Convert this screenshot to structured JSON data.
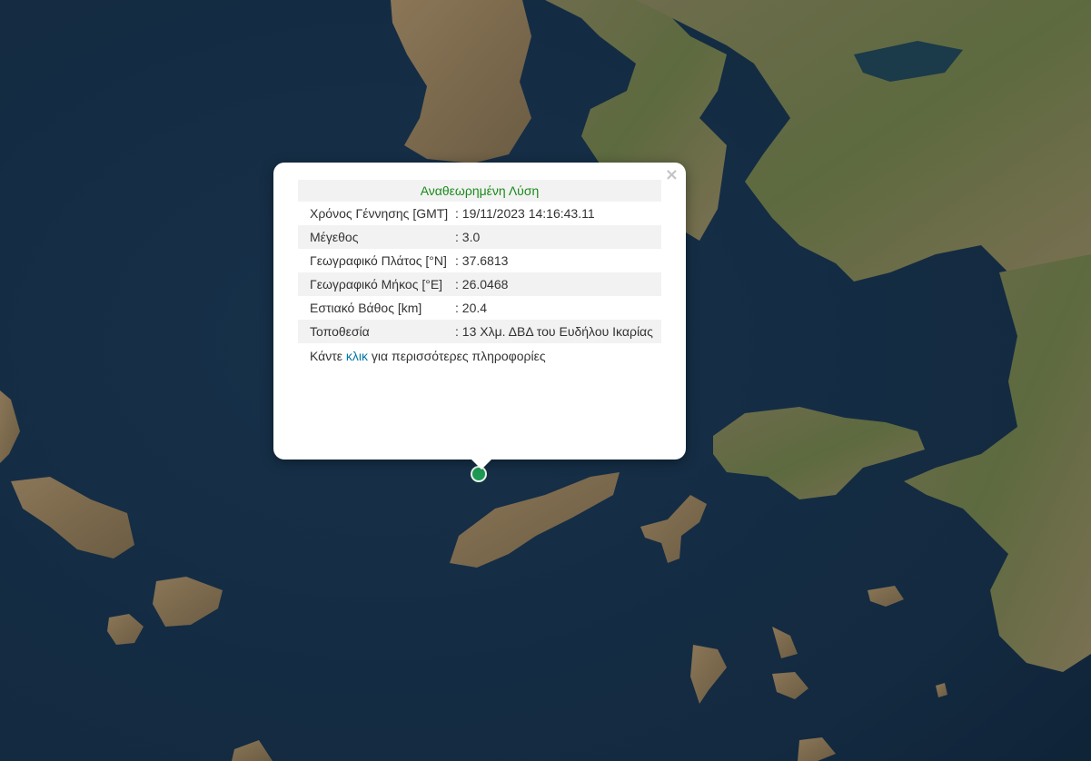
{
  "popup": {
    "close_glyph": "×",
    "header": "Αναθεωρημένη Λύση",
    "rows": [
      {
        "label": "Χρόνος Γέννησης [GMT]",
        "value": ": 19/11/2023 14:16:43.11"
      },
      {
        "label": "Μέγεθος",
        "value": ": 3.0"
      },
      {
        "label": "Γεωγραφικό Πλάτος [°N]",
        "value": ": 37.6813"
      },
      {
        "label": "Γεωγραφικό Μήκος [°E]",
        "value": ": 26.0468"
      },
      {
        "label": "Εστιακό Βάθος [km]",
        "value": ": 20.4"
      },
      {
        "label": "Τοποθεσία",
        "value": ": 13 Χλμ. ΔΒΔ του Ευδήλου Ικαρίας"
      }
    ],
    "more_prefix": "Κάντε ",
    "more_link": "κλικ",
    "more_suffix": " για περισσότερες πληροφορίες"
  },
  "marker": {
    "color": "#1f9a55",
    "icon": "earthquake-marker-icon"
  },
  "map": {
    "basemap": "satellite imagery",
    "sea_color": "#142a3f",
    "land_color": "#6b6a4a"
  }
}
